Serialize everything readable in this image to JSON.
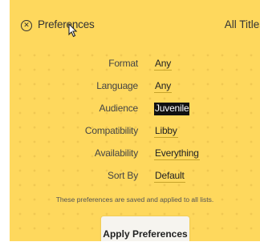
{
  "header": {
    "close_icon": "close-circle-icon",
    "title": "Preferences",
    "right_title": "All Titles"
  },
  "preferences": [
    {
      "label": "Format",
      "value": "Any",
      "selected": false
    },
    {
      "label": "Language",
      "value": "Any",
      "selected": false
    },
    {
      "label": "Audience",
      "value": "Juvenile",
      "selected": true
    },
    {
      "label": "Compatibility",
      "value": "Libby",
      "selected": false
    },
    {
      "label": "Availability",
      "value": "Everything",
      "selected": false
    },
    {
      "label": "Sort By",
      "value": "Default",
      "selected": false
    }
  ],
  "note": "These preferences are saved and applied to all lists.",
  "apply_label": "Apply Preferences",
  "colors": {
    "panel": "#fed85d",
    "selection": "#111111"
  }
}
